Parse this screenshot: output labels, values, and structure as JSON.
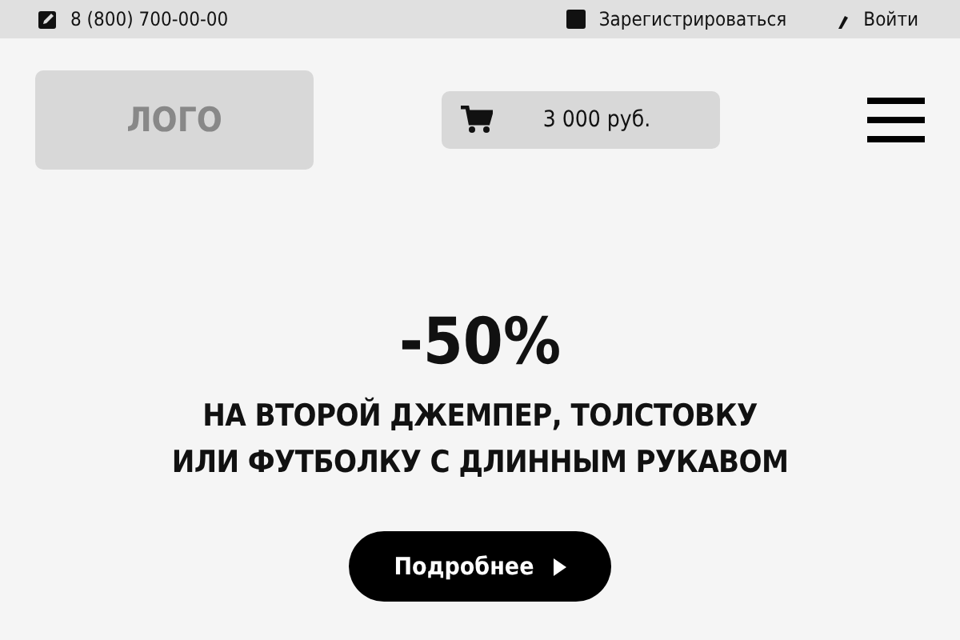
{
  "top_bar": {
    "phone": "8 (800) 700-00-00",
    "register": "Зарегистрироваться",
    "login": "Войти"
  },
  "header": {
    "logo": "ЛОГО",
    "cart_total": "3 000 руб."
  },
  "promo": {
    "discount": "-50%",
    "lines": [
      "НА ВТОРОЙ ДЖЕМПЕР, ТОЛСТОВКУ",
      "ИЛИ ФУТБОЛКУ С ДЛИННЫМ РУКАВОМ"
    ],
    "button": "Подробнее"
  }
}
